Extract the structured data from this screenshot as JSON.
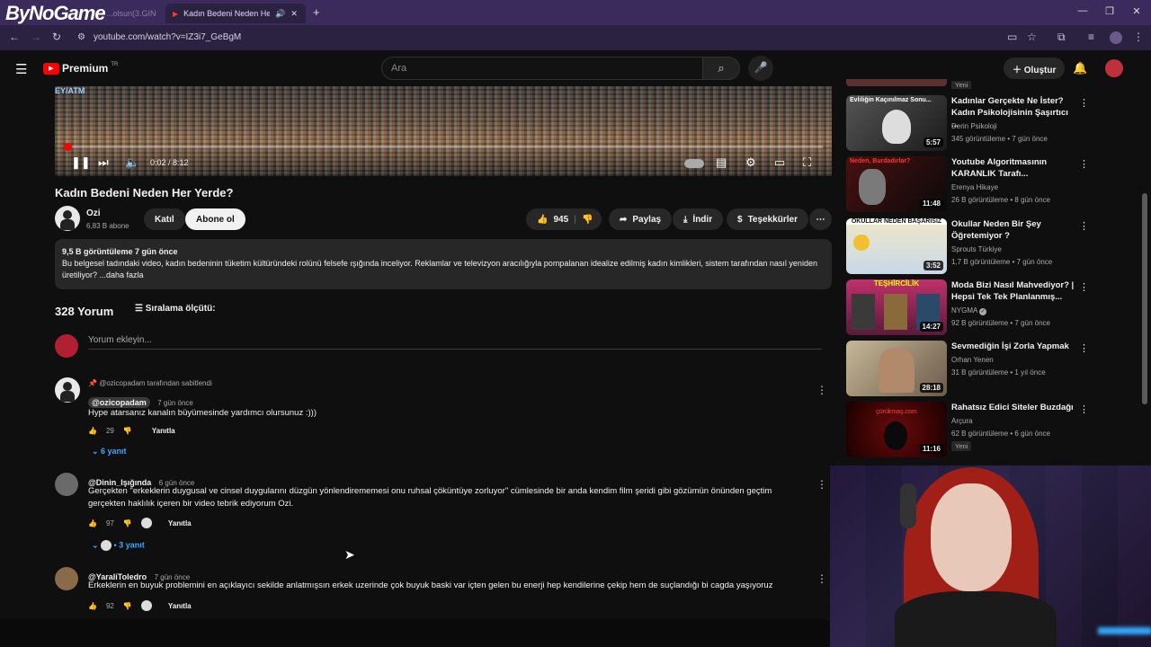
{
  "browser": {
    "watermark": "ByNoGame",
    "tabs": [
      {
        "label": "...olsun(3.GIN"
      },
      {
        "label": "Kadın Bedeni Neden Her Ye"
      }
    ],
    "url": "youtube.com/watch?v=IZ3i7_GeBgM"
  },
  "yt": {
    "brand": "Premium",
    "region": "TR",
    "search_placeholder": "Ara",
    "create_label": "Oluştur"
  },
  "video": {
    "time": "0:02 / 8:12",
    "progress_fraction": 0.004,
    "title": "Kadın Bedeni Neden Her Yerde?"
  },
  "channel": {
    "name": "Ozi",
    "subs": "6,83 B abone",
    "join": "Katıl",
    "subscribe": "Abone ol"
  },
  "actions": {
    "likes": "945",
    "share": "Paylaş",
    "download": "İndir",
    "thanks": "Teşekkürler"
  },
  "description": {
    "meta": "9,5 B görüntüleme  7 gün önce",
    "text": "Bu belgesel tadındaki video, kadın bedeninin tüketim kültüründeki rolünü felsefe ışığında inceliyor. Reklamlar ve televizyon aracılığıyla pompalanan idealize edilmiş kadın kimlikleri, sistem tarafından nasıl yeniden üretiliyor? ...daha fazla"
  },
  "comments": {
    "count": "328 Yorum",
    "sort": "Sıralama ölçütü:",
    "add_placeholder": "Yorum ekleyin...",
    "items": [
      {
        "pinned": "@ozicopadam tarafından sabitlendi",
        "user": "@ozicopadam",
        "ago": "7 gün önce",
        "text": "Hype atarsanız kanalın büyümesinde yardımcı olursunuz :)))",
        "likes": "29",
        "reply": "Yanıtla",
        "replies": "6 yanıt"
      },
      {
        "user": "@Dinin_Işığında",
        "ago": "6 gün önce",
        "text": "Gerçekten \"erkeklerin duygusal ve cinsel duygularını düzgün yönlendirememesi onu ruhsal çöküntüye zorluyor\" cümlesinde bir anda kendim film şeridi gibi gözümün önünden geçtim gerçekten haklılık içeren bir video tebrik ediyorum Ozi.",
        "likes": "97",
        "reply": "Yanıtla",
        "replies": "3 yanıt"
      },
      {
        "user": "@YaraliToledro",
        "ago": "7 gün önce",
        "text": "Erkeklerin en buyuk problemini en açıklayıcı sekilde anlatmışsın erkek uzerinde çok buyuk baski var içten gelen bu enerji hep kendilerine çekip hem de suçlandığı bi cagda yaşıyoruz",
        "likes": "92",
        "reply": "Yanıtla"
      }
    ]
  },
  "sidebar": {
    "top_badge": "Yeni",
    "items": [
      {
        "thumb_text": "Evliliğin Kaçınılmaz Sonu...",
        "duration": "5:57",
        "title": "Kadınlar Gerçekte Ne İster? Kadın Psikolojisinin Şaşırtıcı ...",
        "channel": "Derin Psikoloji",
        "meta": "345 görüntüleme • 7 gün önce",
        "thumb_color": "#2a2a2a"
      },
      {
        "thumb_text": "Neden, Burdadırlar?",
        "duration": "11:48",
        "title": "Youtube Algoritmasının KARANLIK Tarafı...",
        "channel": "Erenya Hikaye",
        "meta": "26 B görüntüleme • 8 gün önce",
        "thumb_color": "#3a1010"
      },
      {
        "thumb_text": "OKULLAR NEDEN BAŞARISIZ",
        "duration": "3:52",
        "title": "Okullar Neden Bir Şey Öğretemiyor ?",
        "channel": "Sprouts Türkiye",
        "meta": "1,7 B görüntüleme • 7 gün önce",
        "thumb_color": "#d8d0b0"
      },
      {
        "thumb_text": "TEŞHİRCİLİK",
        "duration": "14:27",
        "title": "Moda Bizi Nasıl Mahvediyor? | Hepsi Tek Tek Planlanmış...",
        "channel": "NYGMA",
        "meta": "92 B görüntüleme • 7 gün önce",
        "thumb_color": "#b8306a"
      },
      {
        "thumb_text": "",
        "duration": "28:18",
        "title": "Sevmediğin İşi Zorla Yapmak",
        "channel": "Orhan Yenen",
        "meta": "31 B görüntüleme • 1 yıl önce",
        "thumb_color": "#8a7050"
      },
      {
        "thumb_text": "çürükmaş.com",
        "duration": "11:16",
        "title": "Rahatsız Edici Siteler Buzdağı",
        "channel": "Arçura",
        "meta": "62 B görüntüleme • 6 gün önce",
        "badge": "Yeni",
        "thumb_color": "#3a0505"
      }
    ]
  }
}
